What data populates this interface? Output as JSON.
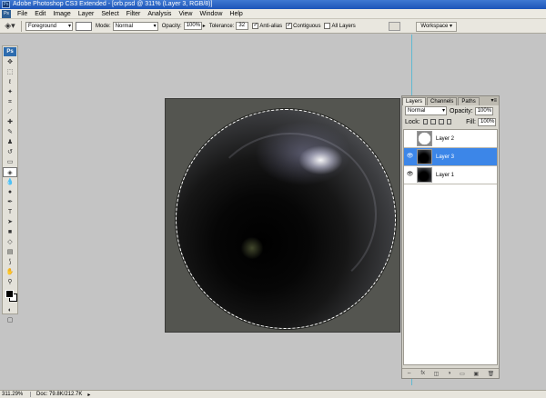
{
  "window": {
    "title": "Adobe Photoshop CS3 Extended - [orb.psd @ 311% (Layer 3, RGB/8)]"
  },
  "menu": [
    "File",
    "Edit",
    "Image",
    "Layer",
    "Select",
    "Filter",
    "Analysis",
    "View",
    "Window",
    "Help"
  ],
  "options": {
    "fill_source": "Foreground",
    "mode_label": "Mode:",
    "mode_value": "Normal",
    "opacity_label": "Opacity:",
    "opacity_value": "100%",
    "tolerance_label": "Tolerance:",
    "tolerance_value": "32",
    "antialias_label": "Anti-alias",
    "contiguous_label": "Contiguous",
    "all_layers_label": "All Layers",
    "workspace_label": "Workspace ▾"
  },
  "layers_panel": {
    "tabs": [
      "Layers",
      "Channels",
      "Paths"
    ],
    "blend_mode": "Normal",
    "opacity_label": "Opacity:",
    "opacity_value": "100%",
    "lock_label": "Lock:",
    "fill_label": "Fill:",
    "fill_value": "100%",
    "layers": [
      {
        "name": "Layer 2",
        "visible": false,
        "selected": false
      },
      {
        "name": "Layer 3",
        "visible": true,
        "selected": true
      },
      {
        "name": "Layer 1",
        "visible": true,
        "selected": false
      }
    ]
  },
  "status": {
    "zoom": "311.29%",
    "doc": "Doc: 79.8K/212.7K"
  },
  "colors": {
    "selection": "#3c86e8",
    "guide": "#47b7d6",
    "canvas_bg": "#545550"
  }
}
